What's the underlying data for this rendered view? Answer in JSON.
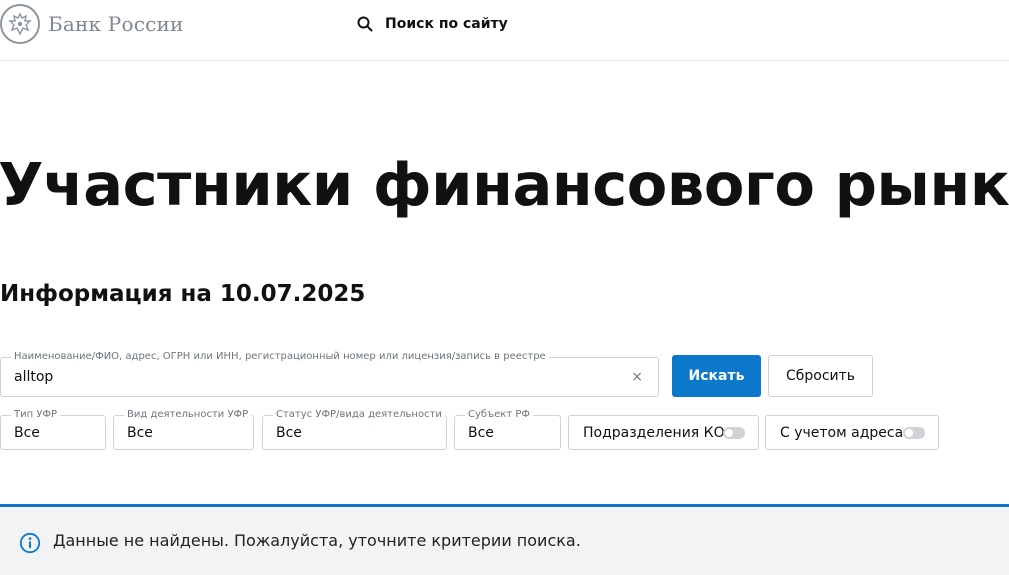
{
  "header": {
    "logo_text": "Банк России",
    "site_search_label": "Поиск по сайту"
  },
  "page_title": "Участники финансового рынка",
  "subtitle": "Информация на 10.07.2025",
  "search": {
    "legend": "Наименование/ФИО, адрес, ОГРН или ИНН, регистрационный номер или лицензия/запись в реестре",
    "value": "alltop",
    "clear_symbol": "×",
    "search_button": "Искать",
    "reset_button": "Сбросить"
  },
  "filters": {
    "ufr_type": {
      "legend": "Тип УФР",
      "value": "Все"
    },
    "ufr_activity": {
      "legend": "Вид деятельности УФР",
      "value": "Все"
    },
    "ufr_status": {
      "legend": "Статус УФР/вида деятельности",
      "value": "Все"
    },
    "region": {
      "legend": "Субъект РФ",
      "value": "Все"
    },
    "ko_divisions": {
      "label": "Подразделения КО",
      "enabled": false
    },
    "with_address": {
      "label": "С учетом адреса",
      "enabled": false
    }
  },
  "message": {
    "text": "Данные не найдены. Пожалуйста, уточните критерии поиска.",
    "accent_color": "#0b78c9"
  },
  "colors": {
    "primary": "#0b78c9",
    "border": "#cfd3d8",
    "info_background": "#f2f3f4"
  }
}
